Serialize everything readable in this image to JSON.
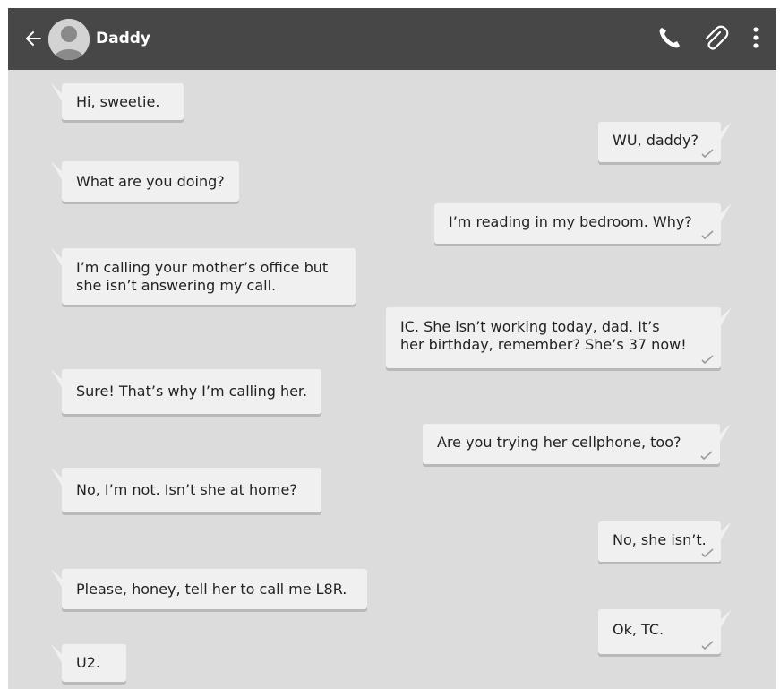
{
  "header": {
    "contact_name": "Daddy",
    "icons": [
      "back-arrow-icon",
      "avatar-icon",
      "phone-icon",
      "paperclip-icon",
      "more-vert-icon"
    ],
    "bar_color": "#474747"
  },
  "messages": [
    {
      "from": "contact",
      "lines": [
        "Hi, sweetie."
      ]
    },
    {
      "from": "me",
      "lines": [
        "WU, daddy?"
      ]
    },
    {
      "from": "contact",
      "lines": [
        "What are you doing?"
      ]
    },
    {
      "from": "me",
      "lines": [
        "I’m reading in my bedroom. Why?"
      ]
    },
    {
      "from": "contact",
      "lines": [
        "I’m calling your mother’s office but",
        "she isn’t answering my call."
      ]
    },
    {
      "from": "me",
      "lines": [
        "IC. She isn’t working today, dad. It’s",
        "her birthday, remember? She’s 37 now!"
      ]
    },
    {
      "from": "contact",
      "lines": [
        "Sure! That’s why I’m calling her."
      ]
    },
    {
      "from": "me",
      "lines": [
        "Are you trying her cellphone, too?"
      ]
    },
    {
      "from": "contact",
      "lines": [
        "No, I’m not. Isn’t she at home?"
      ]
    },
    {
      "from": "me",
      "lines": [
        "No, she isn’t."
      ]
    },
    {
      "from": "contact",
      "lines": [
        "Please, honey, tell her to call me L8R."
      ]
    },
    {
      "from": "me",
      "lines": [
        "Ok, TC."
      ]
    },
    {
      "from": "contact",
      "lines": [
        "U2."
      ]
    }
  ],
  "colors": {
    "background": "#dcdcdc",
    "bubble": "#f0f0f0",
    "bubble_shadow": "#b9b9b9",
    "check": "#9a9a9a"
  }
}
